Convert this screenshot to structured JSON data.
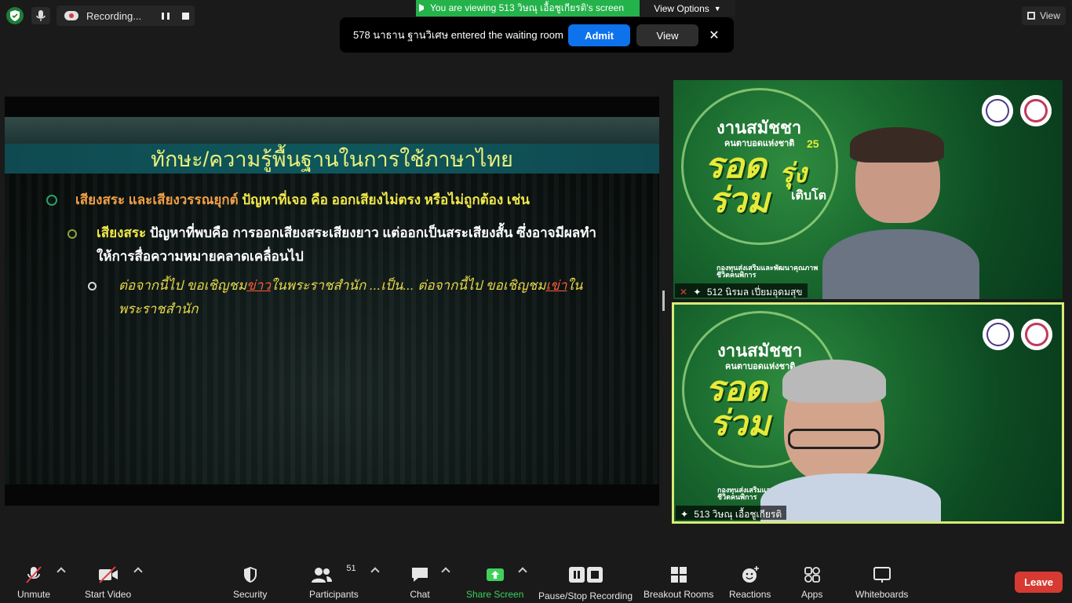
{
  "topbar": {
    "recording_label": "Recording...",
    "viewing_banner": "You are viewing 513 วิษณุ เอื้อชูเกียรติ's screen",
    "view_options": "View Options",
    "view_button": "View"
  },
  "waiting_room": {
    "message": "578 นาธาน ฐานวิเศษ entered the waiting room",
    "admit_label": "Admit",
    "view_label": "View",
    "close_glyph": "✕"
  },
  "slide": {
    "title": "ทักษะ/ความรู้พื้นฐานในการใช้ภาษาไทย",
    "b1_head": "เสียงสระ และเสียงวรรณยุกต์",
    "b1_text": " ปัญหาที่เจอ คือ ออกเสียงไม่ตรง หรือไม่ถูกต้อง เช่น",
    "b2_head": "เสียงสระ",
    "b2_text": " ปัญหาที่พบคือ การออกเสียงสระเสียงยาว แต่ออกเป็นสระเสียงสั้น ซึ่งอาจมีผลทำ",
    "b2_text2": "ให้การสื่อความหมายคลาดเคลื่อนไป",
    "b3_a": "ต่อจากนี้ไป ขอเชิญชม",
    "b3_b": "ข่าว",
    "b3_c": "ในพระราชสำนัก ...เป็น... ต่อจากนี้ไป ขอเชิญชม",
    "b3_d": "เข่า",
    "b3_e": "ใน",
    "b3_f": "พระราชสำนัก"
  },
  "tiles": [
    {
      "name": "512  นิรมล  เปี่ยมอุดมสุข",
      "poster_line1": "งานสมัชชา",
      "poster_line2": "คนตาบอดแห่งชาติ",
      "poster_no": "25",
      "poster_big1": "รอด",
      "poster_big2": "รุ่ง",
      "poster_big3": "ร่วม",
      "poster_small": "เติบโต",
      "poster_org": "กองทุนส่งเสริมและพัฒนาคุณภาพชีวิตคนพิการ"
    },
    {
      "name": "513 วิษณุ เอื้อชูเกียรติ",
      "poster_line1": "งานสมัชชา",
      "poster_line2": "คนตาบอดแห่งชาติ",
      "poster_big1": "รอด",
      "poster_big3": "ร่วม",
      "poster_org": "กองทุนส่งเสริมและพัฒนาคุณภาพชีวิตคนพิการ"
    }
  ],
  "toolbar": {
    "unmute": "Unmute",
    "start_video": "Start Video",
    "security": "Security",
    "participants": "Participants",
    "participants_count": "51",
    "chat": "Chat",
    "share_screen": "Share Screen",
    "pause_stop": "Pause/Stop Recording",
    "breakout": "Breakout Rooms",
    "reactions": "Reactions",
    "apps": "Apps",
    "whiteboards": "Whiteboards",
    "leave": "Leave"
  },
  "colors": {
    "accent_blue": "#0e72ed",
    "share_green": "#24b34a",
    "leave_red": "#d63a32",
    "active_speaker": "#d7eb76"
  }
}
